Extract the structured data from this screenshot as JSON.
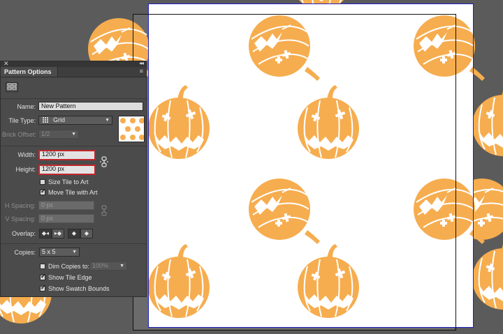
{
  "colors": {
    "pumpkin": "#f6ad4f",
    "canvas_bg": "#5b5b5b",
    "tile_bg": "#ffffff",
    "tile_edge": "#2020c0",
    "panel_bg": "#4b4b4b",
    "highlight": "#c0262c"
  },
  "panel": {
    "title": "Pattern Options",
    "close_glyph": "✕",
    "collapse_glyph": "◂◂",
    "menu_glyph": "≡",
    "name_label": "Name:",
    "name_value": "New Pattern",
    "tile_type_label": "Tile Type:",
    "tile_type_value": "Grid",
    "brick_offset_label": "Brick Offset:",
    "brick_offset_value": "1/2",
    "width_label": "Width:",
    "width_value": "1200 px",
    "height_label": "Height:",
    "height_value": "1200 px",
    "size_tile_to_art": "Size Tile to Art",
    "move_tile_with_art": "Move Tile with Art",
    "h_spacing_label": "H Spacing:",
    "h_spacing_value": "0 px",
    "v_spacing_label": "V Spacing:",
    "v_spacing_value": "0 px",
    "overlap_label": "Overlap:",
    "copies_label": "Copies:",
    "copies_value": "5 x 5",
    "dim_copies_label": "Dim Copies to:",
    "dim_copies_value": "100%",
    "show_tile_edge": "Show Tile Edge",
    "show_swatch_bounds": "Show Swatch Bounds"
  },
  "checks": {
    "size_tile_to_art": false,
    "move_tile_with_art": true,
    "dim_copies": false,
    "show_tile_edge": true,
    "show_swatch_bounds": true
  }
}
